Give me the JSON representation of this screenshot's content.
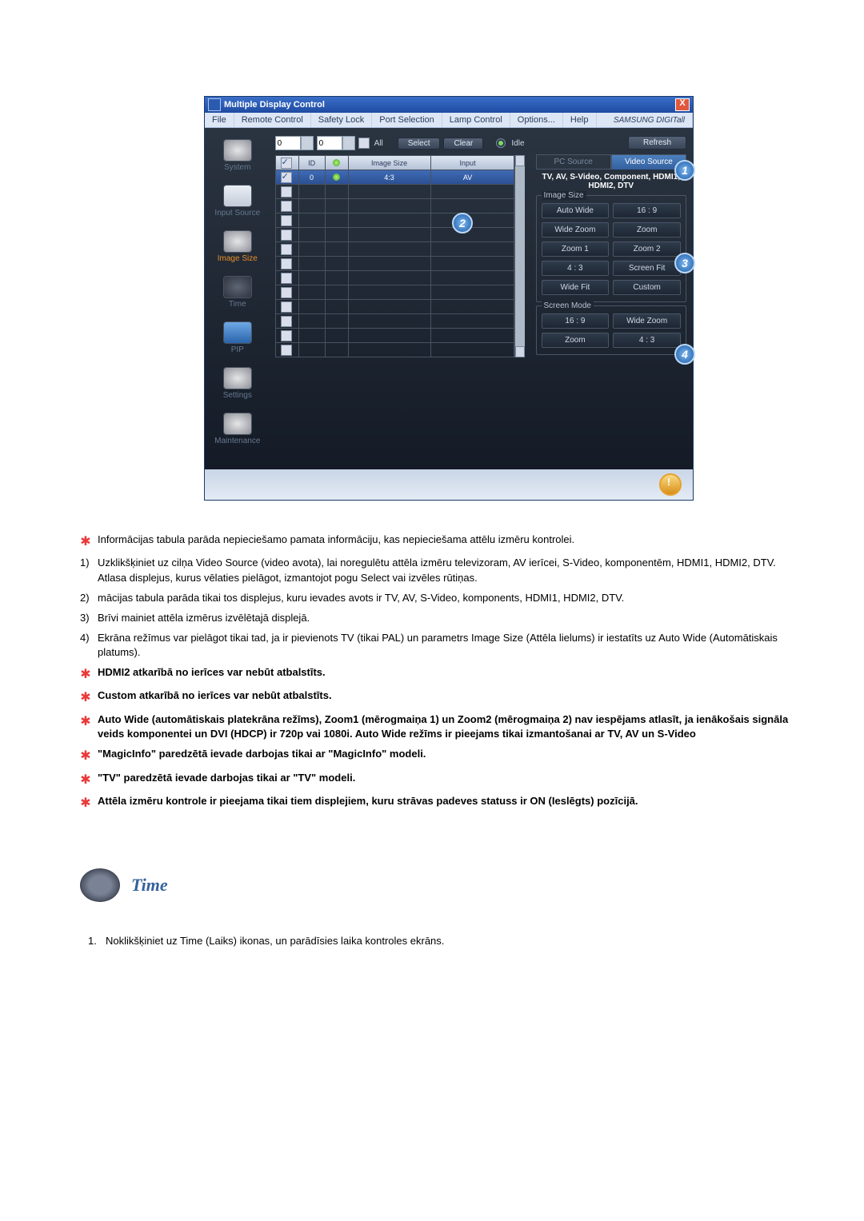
{
  "app": {
    "title": "Multiple Display Control",
    "menu": [
      "File",
      "Remote Control",
      "Safety Lock",
      "Port Selection",
      "Lamp Control",
      "Options...",
      "Help"
    ],
    "brand": "SAMSUNG DIGITall"
  },
  "sidebar": {
    "items": [
      {
        "label": "System"
      },
      {
        "label": "Input Source"
      },
      {
        "label": "Image Size"
      },
      {
        "label": "Time"
      },
      {
        "label": "PIP"
      },
      {
        "label": "Settings"
      },
      {
        "label": "Maintenance"
      }
    ]
  },
  "top": {
    "spin1": "0",
    "spin2": "0",
    "all": "All",
    "select": "Select",
    "clear": "Clear",
    "idle": "Idle",
    "refresh": "Refresh"
  },
  "grid": {
    "head": {
      "id": "ID",
      "size": "Image Size",
      "input": "Input"
    },
    "row0": {
      "id": "0",
      "size": "4:3",
      "input": "AV"
    }
  },
  "right": {
    "tab_pc": "PC Source",
    "tab_video": "Video Source",
    "info": "TV, AV, S-Video, Component, HDMI1, HDMI2, DTV",
    "group1": "Image Size",
    "btns1": [
      "Auto Wide",
      "16 : 9",
      "Wide Zoom",
      "Zoom",
      "Zoom 1",
      "Zoom 2",
      "4 : 3",
      "Screen Fit",
      "Wide Fit",
      "Custom"
    ],
    "group2": "Screen Mode",
    "btns2": [
      "16 : 9",
      "Wide Zoom",
      "Zoom",
      "4 : 3"
    ]
  },
  "callouts": {
    "c1": "1",
    "c2": "2",
    "c3": "3",
    "c4": "4"
  },
  "doc": {
    "p_star1": "Informācijas tabula parāda nepieciešamo pamata informāciju, kas nepieciešama attēlu izmēru kontrolei.",
    "n1": "1)",
    "t1a": "Uzklikšķiniet uz cilņa Video Source (video avota), lai noregulētu attēla izmēru televizoram, AV ierīcei, S-Video, komponentēm, HDMI1, HDMI2, DTV.",
    "t1b": "Atlasa displejus, kurus vēlaties pielāgot, izmantojot pogu Select vai izvēles rūtiņas.",
    "n2": "2)",
    "t2": "mācijas tabula parāda tikai tos displejus, kuru ievades avots ir TV, AV, S-Video, komponents, HDMI1, HDMI2, DTV.",
    "n3": "3)",
    "t3": "Brīvi mainiet attēla izmērus izvēlētajā displejā.",
    "n4": "4)",
    "t4": "Ekrāna režīmus var pielāgot tikai tad, ja ir pievienots TV (tikai PAL) un parametrs Image Size (Attēla lielums) ir iestatīts uz Auto Wide (Automātiskais platums).",
    "b1": "HDMI2 atkarībā no ierīces var nebūt atbalstīts.",
    "b2": "Custom atkarībā no ierīces var nebūt atbalstīts.",
    "b3": "Auto Wide (automātiskais platekrāna režīms), Zoom1 (mērogmaiņa 1) un Zoom2 (mērogmaiņa 2) nav iespējams atlasīt, ja ienākošais signāla veids komponentei un DVI (HDCP) ir 720p vai 1080i. Auto Wide režīms ir pieejams tikai izmantošanai ar TV, AV un S-Video",
    "b4": "\"MagicInfo\" paredzētā ievade darbojas tikai ar \"MagicInfo\" modeli.",
    "b5": "\"TV\" paredzētā ievade darbojas tikai ar \"TV\" modeli.",
    "b6": "Attēla izmēru kontrole ir pieejama tikai tiem displejiem, kuru strāvas padeves statuss ir ON (Ieslēgts) pozīcijā.",
    "time_title": "Time",
    "time_n": "1.",
    "time_t": "Noklikšķiniet uz Time (Laiks) ikonas, un parādīsies laika kontroles ekrāns."
  }
}
